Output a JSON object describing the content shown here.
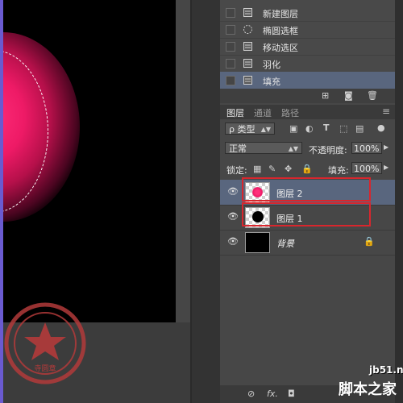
{
  "history": {
    "items": [
      {
        "label": "新建图层",
        "icon": "document-icon",
        "selected": false
      },
      {
        "label": "椭圆选框",
        "icon": "ellipse-marquee-icon",
        "selected": false
      },
      {
        "label": "移动选区",
        "icon": "document-icon",
        "selected": false
      },
      {
        "label": "羽化",
        "icon": "document-icon",
        "selected": false
      },
      {
        "label": "填充",
        "icon": "document-icon",
        "selected": true
      }
    ]
  },
  "layers_panel": {
    "tabs": [
      "图层",
      "通道",
      "路径"
    ],
    "filter_label": "ρ 类型",
    "blend_mode": "正常",
    "opacity_label": "不透明度:",
    "opacity_value": "100%",
    "lock_label": "锁定:",
    "fill_label": "填充:",
    "fill_value": "100%",
    "layers": [
      {
        "name": "图层 2",
        "selected": true,
        "highlighted": true,
        "thumb": "pink-circle"
      },
      {
        "name": "图层 1",
        "selected": false,
        "highlighted": true,
        "thumb": "black-circle"
      },
      {
        "name": "背景",
        "selected": false,
        "highlighted": false,
        "thumb": "black",
        "locked": true
      }
    ]
  },
  "stamp_text": "我是一个大坏蛋 · 寺圆章",
  "watermark": {
    "site": "jb51.net",
    "name": "脚本之家"
  },
  "colors": {
    "accent_selection": "#59667e",
    "highlight_box": "#d8262d",
    "glow": "#ee1a66"
  }
}
